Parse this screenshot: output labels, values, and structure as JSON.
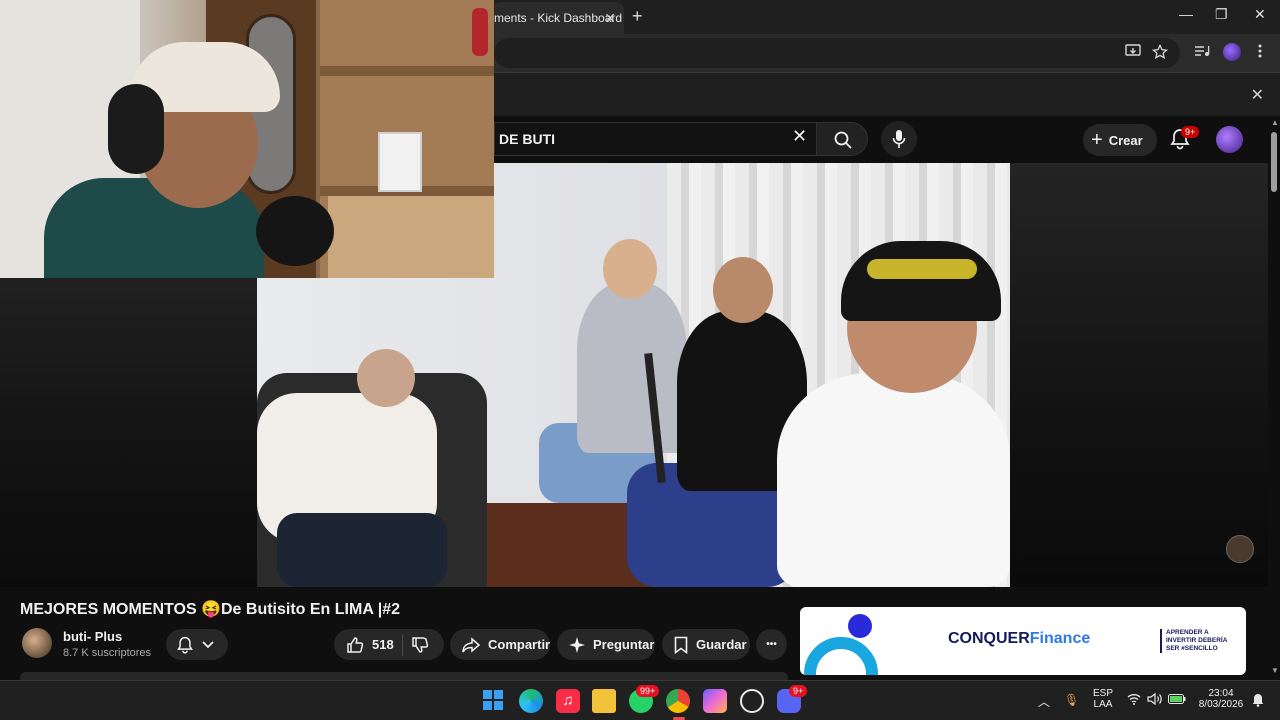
{
  "browser": {
    "tab_title": "ments - Kick Dashboard",
    "tab_close": "✕",
    "new_tab": "+",
    "window_controls": {
      "minimize": "—",
      "maximize": "❐",
      "close": "✕"
    },
    "infobar_close": "✕"
  },
  "youtube": {
    "search_value": "DE BUTI",
    "search_clear": "✕",
    "create_label": "Crear",
    "create_plus": "+",
    "notifications_badge": "9+"
  },
  "video": {
    "title": "MEJORES MOMENTOS 😝De Butisito En LIMA |#2",
    "channel_name": "buti- Plus",
    "channel_subscribers": "8.7 K suscriptores",
    "likes": "518",
    "share_label": "Compartir",
    "ask_label": "Preguntar",
    "save_label": "Guardar",
    "more_label": "•••"
  },
  "ad": {
    "brand_part1": "CONQUER",
    "brand_part2": "Finance",
    "tagline": "APRENDER A INVERTIR DEBERÍA SER #SENCILLO"
  },
  "taskbar": {
    "whatsapp_badge": "99+",
    "discord_badge": "9+",
    "language_line1": "ESP",
    "language_line2": "LAA",
    "time": "23:04",
    "date": "8/03/2026"
  },
  "colors": {
    "yt_background": "#0f0f0f",
    "pill_background": "#272727",
    "notification_red": "#cc0000",
    "ad_blue": "#1aa7e0",
    "ad_navy": "#151a5a"
  },
  "icons": [
    "search-icon",
    "mic-icon",
    "bell-icon",
    "like-icon",
    "dislike-icon",
    "share-icon",
    "sparkle-icon",
    "bookmark-icon",
    "windows-start-icon",
    "edge-icon",
    "music-icon",
    "folder-icon",
    "whatsapp-icon",
    "chrome-icon",
    "copilot-icon",
    "github-icon",
    "discord-icon"
  ]
}
